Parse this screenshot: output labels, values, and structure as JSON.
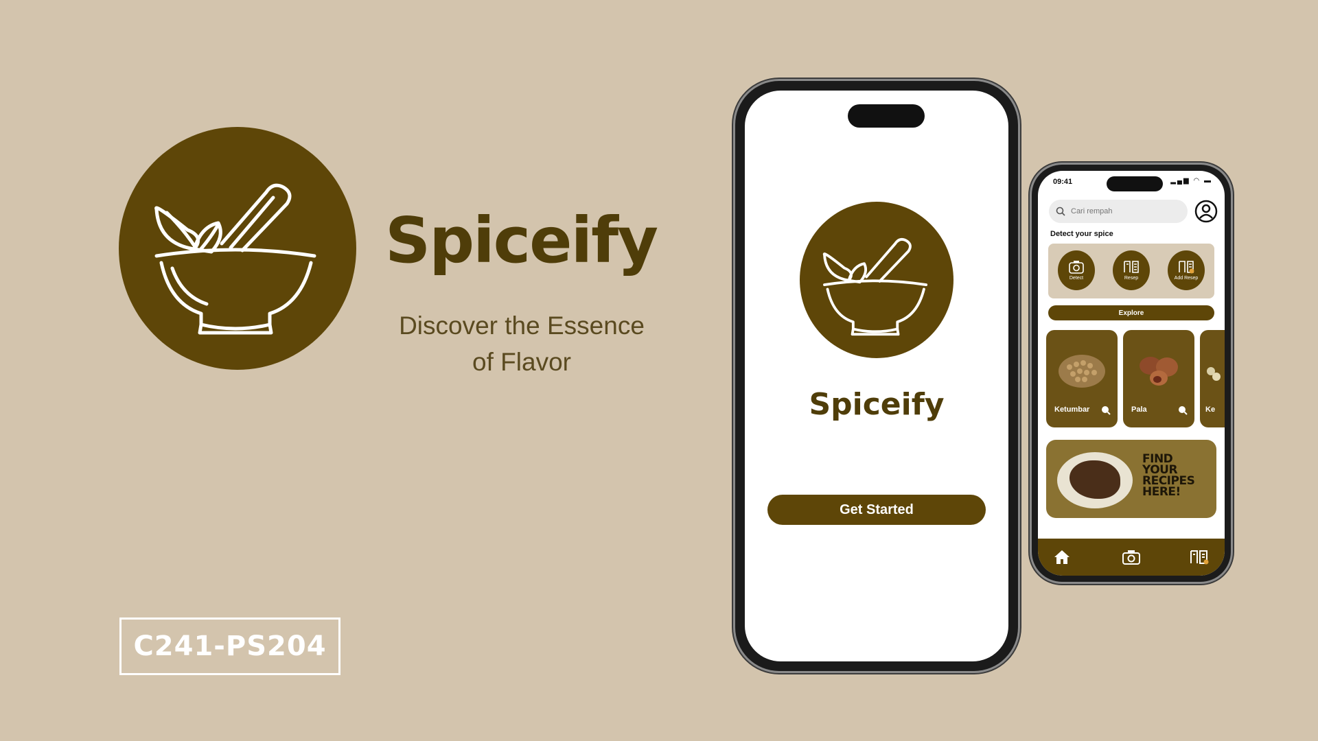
{
  "hero": {
    "title": "Spiceify",
    "tagline_line1": "Discover the Essence",
    "tagline_line2": "of Flavor",
    "team_code": "C241-PS204"
  },
  "splash_screen": {
    "title": "Spiceify",
    "get_started_label": "Get Started"
  },
  "home_screen": {
    "status_time": "09:41",
    "search_placeholder": "Cari rempah",
    "detect_label": "Detect your spice",
    "actions": [
      {
        "label": "Detect",
        "icon": "camera-icon"
      },
      {
        "label": "Resep",
        "icon": "recipe-book-icon"
      },
      {
        "label": "Add Resep",
        "icon": "add-recipe-icon"
      }
    ],
    "explore_label": "Explore",
    "spices": [
      {
        "name": "Ketumbar"
      },
      {
        "name": "Pala"
      },
      {
        "name": "Ke"
      }
    ],
    "recipe_banner": {
      "line1": "FIND",
      "line2": "YOUR",
      "line3": "RECIPES",
      "line4": "HERE!"
    },
    "nav": [
      {
        "icon": "home-icon"
      },
      {
        "icon": "camera-icon"
      },
      {
        "icon": "recipe-book-icon"
      }
    ]
  },
  "colors": {
    "background": "#d3c4ad",
    "brand_brown": "#5e4608",
    "title_brown": "#4f3d09"
  }
}
